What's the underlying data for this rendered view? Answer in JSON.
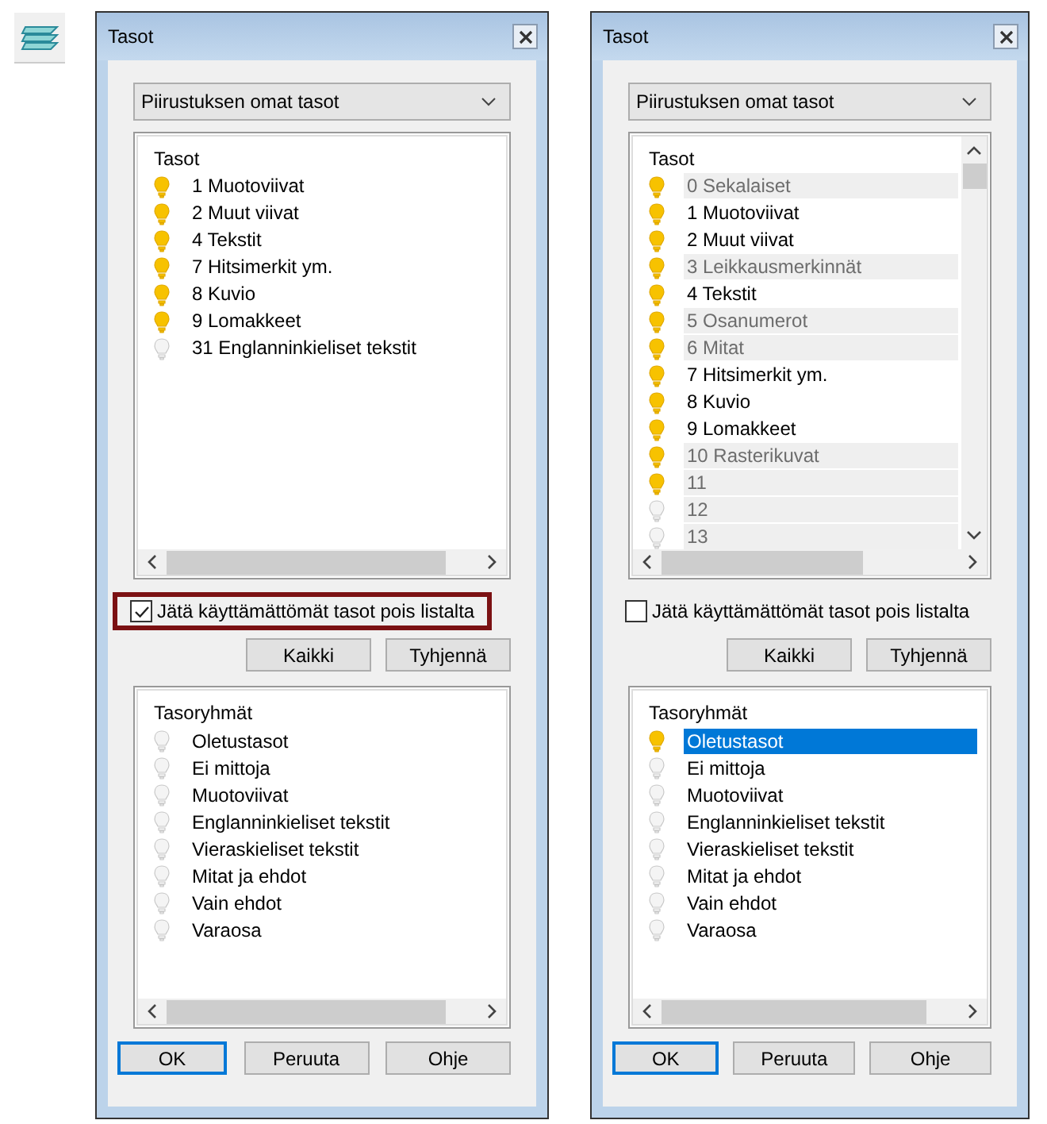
{
  "dialogs": [
    {
      "title": "Tasot",
      "source": "Piirustuksen omat tasot",
      "layers_header": "Tasot",
      "vertical_scroll": false,
      "layers": [
        {
          "label": "1 Muotoviivat",
          "on": true,
          "unused": false
        },
        {
          "label": "2 Muut viivat",
          "on": true,
          "unused": false
        },
        {
          "label": "4 Tekstit",
          "on": true,
          "unused": false
        },
        {
          "label": "7 Hitsimerkit ym.",
          "on": true,
          "unused": false
        },
        {
          "label": "8 Kuvio",
          "on": true,
          "unused": false
        },
        {
          "label": "9 Lomakkeet",
          "on": true,
          "unused": false
        },
        {
          "label": "31 Englanninkieliset tekstit",
          "on": false,
          "unused": false
        }
      ],
      "hide_unused": {
        "label": "Jätä käyttämättömät tasot pois listalta",
        "checked": true,
        "highlighted": true
      },
      "list_buttons": [
        "Kaikki",
        "Tyhjennä"
      ],
      "groups_header": "Tasoryhmät",
      "groups": [
        {
          "label": "Oletustasot",
          "on": false,
          "selected": false
        },
        {
          "label": "Ei mittoja",
          "on": false,
          "selected": false
        },
        {
          "label": "Muotoviivat",
          "on": false,
          "selected": false
        },
        {
          "label": "Englanninkieliset tekstit",
          "on": false,
          "selected": false
        },
        {
          "label": "Vieraskieliset tekstit",
          "on": false,
          "selected": false
        },
        {
          "label": "Mitat ja ehdot",
          "on": false,
          "selected": false
        },
        {
          "label": "Vain ehdot",
          "on": false,
          "selected": false
        },
        {
          "label": "Varaosa",
          "on": false,
          "selected": false
        }
      ],
      "buttons": [
        "OK",
        "Peruuta",
        "Ohje"
      ]
    },
    {
      "title": "Tasot",
      "source": "Piirustuksen omat tasot",
      "layers_header": "Tasot",
      "vertical_scroll": true,
      "layers": [
        {
          "label": "0 Sekalaiset",
          "on": true,
          "unused": true
        },
        {
          "label": "1 Muotoviivat",
          "on": true,
          "unused": false
        },
        {
          "label": "2 Muut viivat",
          "on": true,
          "unused": false
        },
        {
          "label": "3 Leikkausmerkinnät",
          "on": true,
          "unused": true
        },
        {
          "label": "4 Tekstit",
          "on": true,
          "unused": false
        },
        {
          "label": "5 Osanumerot",
          "on": true,
          "unused": true
        },
        {
          "label": "6 Mitat",
          "on": true,
          "unused": true
        },
        {
          "label": "7 Hitsimerkit ym.",
          "on": true,
          "unused": false
        },
        {
          "label": "8 Kuvio",
          "on": true,
          "unused": false
        },
        {
          "label": "9 Lomakkeet",
          "on": true,
          "unused": false
        },
        {
          "label": "10 Rasterikuvat",
          "on": true,
          "unused": true
        },
        {
          "label": "11",
          "on": true,
          "unused": true
        },
        {
          "label": "12",
          "on": false,
          "unused": true
        },
        {
          "label": "13",
          "on": false,
          "unused": true
        }
      ],
      "hide_unused": {
        "label": "Jätä käyttämättömät tasot pois listalta",
        "checked": false,
        "highlighted": false
      },
      "list_buttons": [
        "Kaikki",
        "Tyhjennä"
      ],
      "groups_header": "Tasoryhmät",
      "groups": [
        {
          "label": "Oletustasot",
          "on": true,
          "selected": true
        },
        {
          "label": "Ei mittoja",
          "on": false,
          "selected": false
        },
        {
          "label": "Muotoviivat",
          "on": false,
          "selected": false
        },
        {
          "label": "Englanninkieliset tekstit",
          "on": false,
          "selected": false
        },
        {
          "label": "Vieraskieliset tekstit",
          "on": false,
          "selected": false
        },
        {
          "label": "Mitat ja ehdot",
          "on": false,
          "selected": false
        },
        {
          "label": "Vain ehdot",
          "on": false,
          "selected": false
        },
        {
          "label": "Varaosa",
          "on": false,
          "selected": false
        }
      ],
      "buttons": [
        "OK",
        "Peruuta",
        "Ohje"
      ]
    }
  ]
}
